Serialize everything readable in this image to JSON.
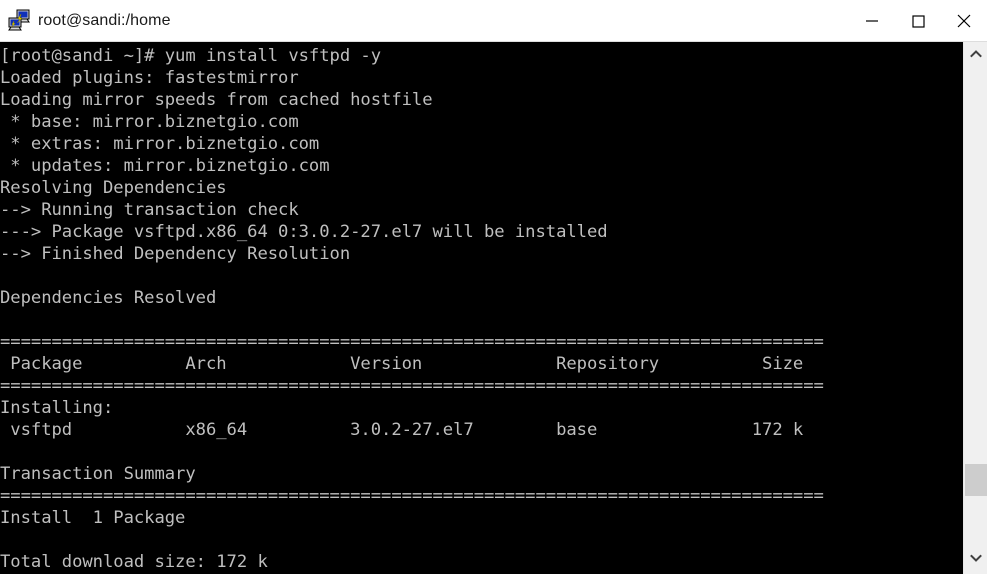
{
  "window": {
    "title": "root@sandi:/home",
    "icon": "putty-terminal-icon",
    "controls": {
      "minimize_label": "Minimize",
      "maximize_label": "Maximize",
      "close_label": "Close"
    }
  },
  "terminal": {
    "foreground_color": "#bfbfbf",
    "background_color": "#000000",
    "lines": [
      "[root@sandi ~]# yum install vsftpd -y",
      "Loaded plugins: fastestmirror",
      "Loading mirror speeds from cached hostfile",
      " * base: mirror.biznetgio.com",
      " * extras: mirror.biznetgio.com",
      " * updates: mirror.biznetgio.com",
      "Resolving Dependencies",
      "--> Running transaction check",
      "---> Package vsftpd.x86_64 0:3.0.2-27.el7 will be installed",
      "--> Finished Dependency Resolution",
      "",
      "Dependencies Resolved",
      "",
      "================================================================================",
      " Package          Arch            Version             Repository          Size",
      "================================================================================",
      "Installing:",
      " vsftpd           x86_64          3.0.2-27.el7        base               172 k",
      "",
      "Transaction Summary",
      "================================================================================",
      "Install  1 Package",
      "",
      "Total download size: 172 k"
    ],
    "command": "yum install vsftpd -y",
    "prompt": "[root@sandi ~]#",
    "table": {
      "headers": [
        "Package",
        "Arch",
        "Version",
        "Repository",
        "Size"
      ],
      "section": "Installing:",
      "rows": [
        [
          "vsftpd",
          "x86_64",
          "3.0.2-27.el7",
          "base",
          "172 k"
        ]
      ]
    },
    "summary": {
      "heading": "Transaction Summary",
      "install_line": "Install  1 Package",
      "total_download_size": "Total download size: 172 k"
    },
    "mirrors": {
      "base": "mirror.biznetgio.com",
      "extras": "mirror.biznetgio.com",
      "updates": "mirror.biznetgio.com"
    }
  },
  "scrollbar": {
    "up_arrow": "chevron-up-icon",
    "down_arrow": "chevron-down-icon",
    "thumb_label": "scroll-thumb"
  }
}
